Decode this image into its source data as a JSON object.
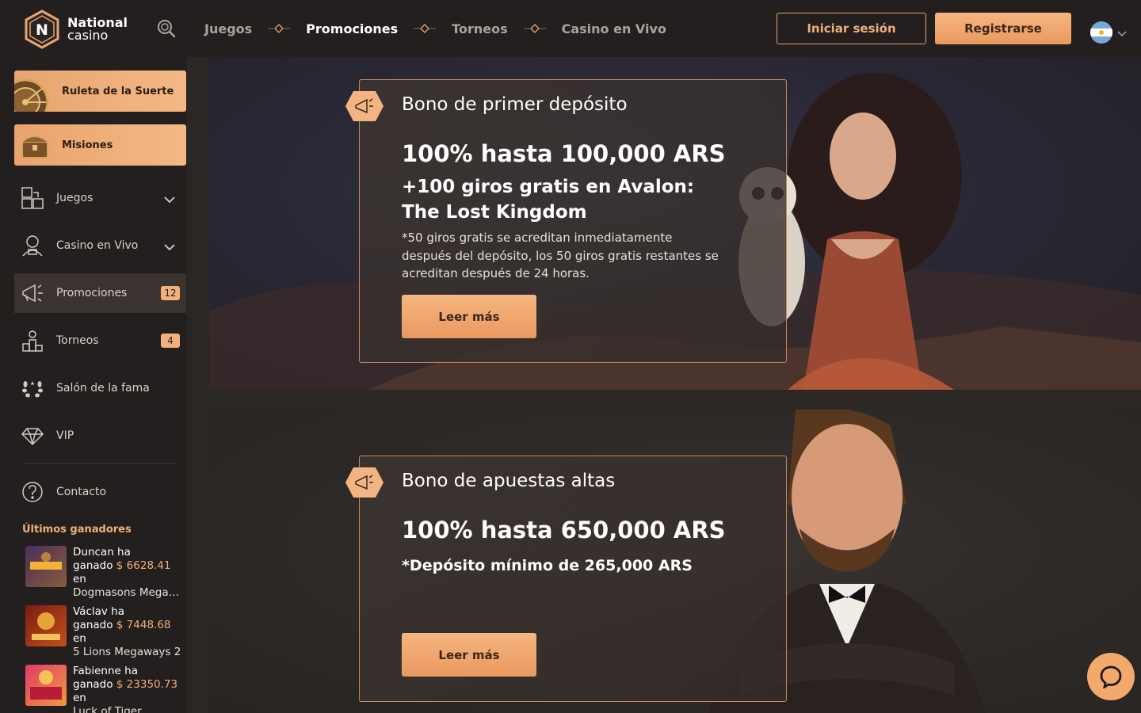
{
  "brand": {
    "line1": "National",
    "line2": "casino",
    "logo_letter": "N"
  },
  "header": {
    "search_icon": "search-icon",
    "nav": [
      {
        "label": "Juegos",
        "active": false
      },
      {
        "label": "Promociones",
        "active": true
      },
      {
        "label": "Torneos",
        "active": false
      },
      {
        "label": "Casino en Vivo",
        "active": false
      }
    ],
    "login_label": "Iniciar sesión",
    "register_label": "Registrarse",
    "language_flag": "argentina-flag-icon"
  },
  "sidebar": {
    "promo_buttons": [
      {
        "label": "Ruleta de la Suerte",
        "icon": "wheel-icon"
      },
      {
        "label": "Misiones",
        "icon": "treasure-chest-icon"
      }
    ],
    "items": [
      {
        "label": "Juegos",
        "icon": "puzzle-icon",
        "expandable": true
      },
      {
        "label": "Casino en Vivo",
        "icon": "live-dealer-icon",
        "expandable": true
      },
      {
        "label": "Promociones",
        "icon": "megaphone-icon",
        "badge": "12",
        "active": true
      },
      {
        "label": "Torneos",
        "icon": "podium-icon",
        "badge": "4"
      },
      {
        "label": "Salón de la fama",
        "icon": "laurel-icon"
      },
      {
        "label": "VIP",
        "icon": "diamond-icon"
      },
      {
        "label": "Contacto",
        "icon": "help-icon"
      }
    ],
    "winners_title": "Últimos ganadores",
    "winners": [
      {
        "name": "Duncan ha",
        "won": "ganado",
        "amount": "$ 6628.41",
        "in": "en",
        "game": "Dogmasons Megaways"
      },
      {
        "name": "Václav ha",
        "won": "ganado",
        "amount": "$ 7448.68",
        "in": "en",
        "game": "5 Lions Megaways 2"
      },
      {
        "name": "Fabienne ha",
        "won": "ganado",
        "amount": "$ 23350.73",
        "in": "en",
        "game": "Luck of Tiger"
      }
    ]
  },
  "promotions": [
    {
      "title": "Bono de primer depósito",
      "headline": "100% hasta 100,000 ARS",
      "subline": "+100 giros gratis en Avalon: The Lost Kingdom",
      "note": "*50 giros gratis se acreditan inmediatamente después del depósito, los 50 giros gratis restantes se acreditan después de 24 horas.",
      "cta": "Leer más"
    },
    {
      "title": "Bono de apuestas altas",
      "headline": "100% hasta 650,000 ARS",
      "subline": "*Depósito mínimo de 265,000 ARS",
      "cta": "Leer más"
    }
  ],
  "colors": {
    "accent": "#f3b07a",
    "background": "#2b2725",
    "sidebar": "#221f1e"
  },
  "chat_icon": "chat-bubble-icon"
}
